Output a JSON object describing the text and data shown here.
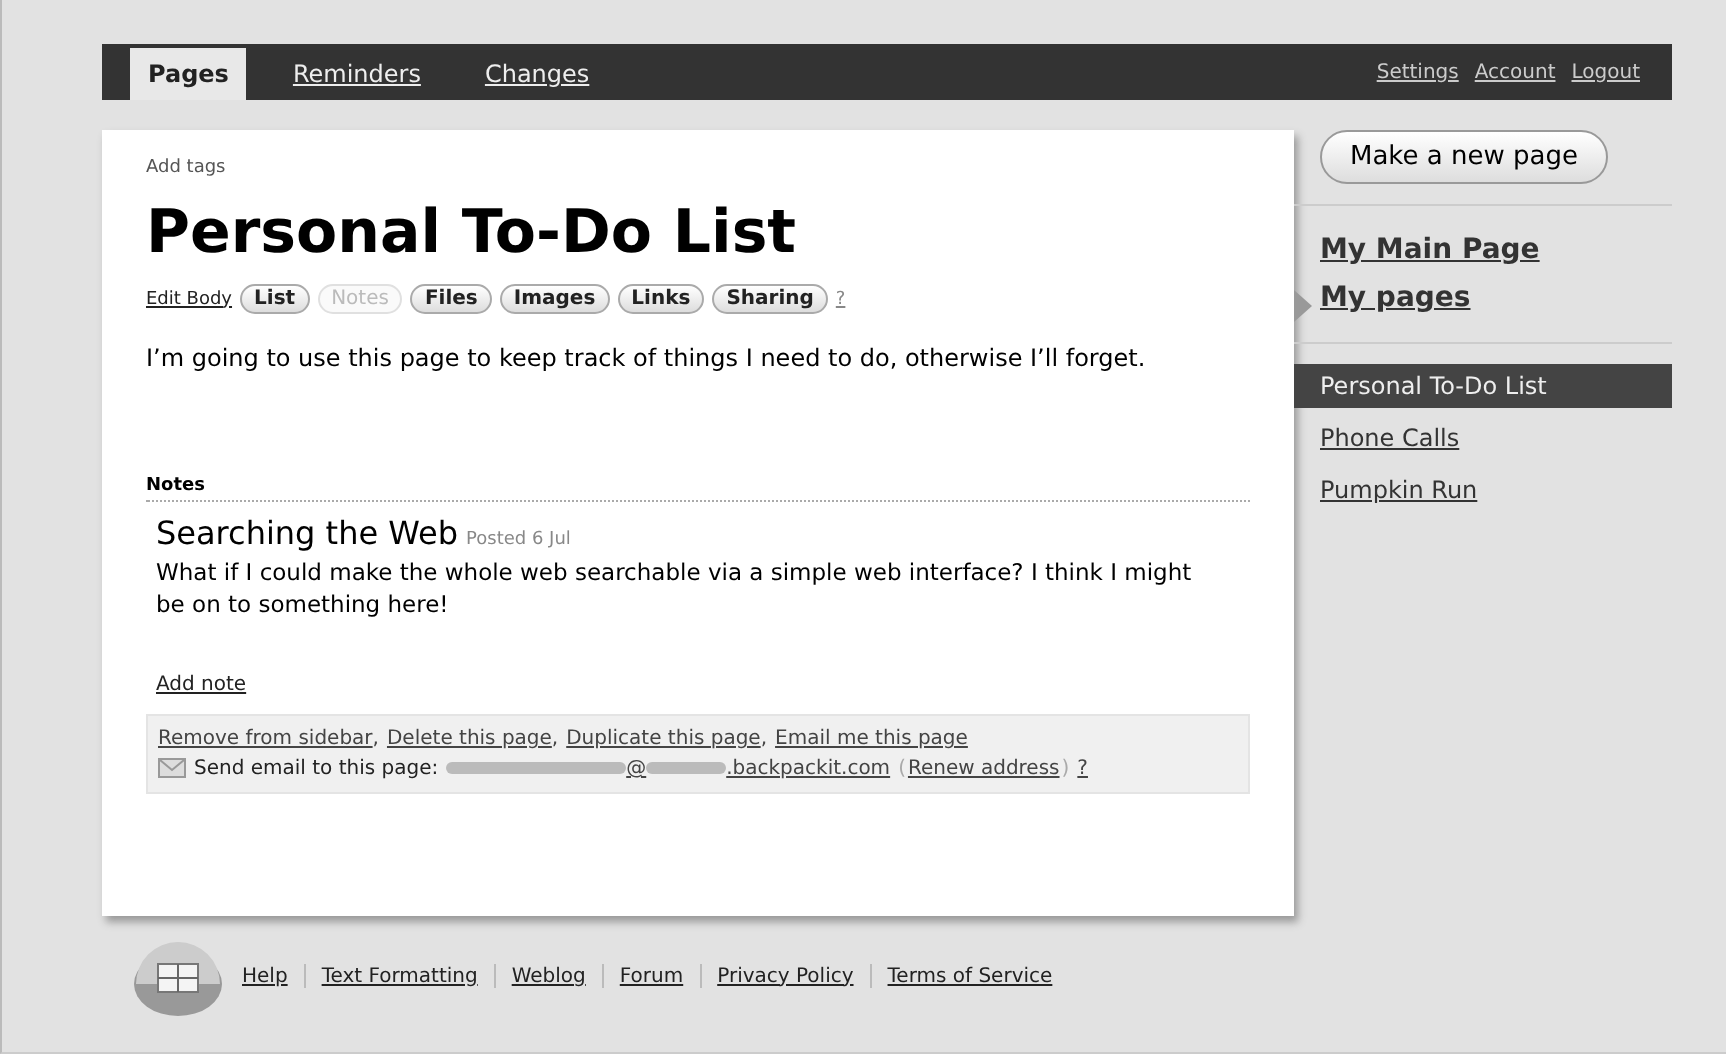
{
  "top_tabs": [
    {
      "label": "Pages",
      "selected": true
    },
    {
      "label": "Reminders",
      "selected": false
    },
    {
      "label": "Changes",
      "selected": false
    }
  ],
  "account_links": [
    "Settings",
    "Account",
    "Logout"
  ],
  "add_tags": "Add tags",
  "title": "Personal To-Do List",
  "edit_body": "Edit Body",
  "insert_buttons": [
    {
      "label": "List",
      "disabled": false
    },
    {
      "label": "Notes",
      "disabled": true
    },
    {
      "label": "Files",
      "disabled": false
    },
    {
      "label": "Images",
      "disabled": false
    },
    {
      "label": "Links",
      "disabled": false
    },
    {
      "label": "Sharing",
      "disabled": false
    }
  ],
  "help_mark": "?",
  "body": "I’m going to use this page to keep track of things I need to do, otherwise I’ll forget.",
  "notes": {
    "heading": "Notes",
    "items": [
      {
        "title": "Searching the Web",
        "posted": "Posted 6 Jul",
        "text": "What if I could make the whole web searchable via a simple web interface? I think I might be on to something here!"
      }
    ],
    "add_note": "Add note"
  },
  "page_actions": [
    "Remove from sidebar",
    "Delete this page",
    "Duplicate this page",
    "Email me this page"
  ],
  "action_separator": ",",
  "email": {
    "label": "Send email to this page:",
    "at": "@",
    "domain": ".backpackit.com",
    "renew": "Renew address",
    "brackets": [
      "(",
      ")"
    ],
    "help": "?"
  },
  "sidebar": {
    "new_page": "Make a new page",
    "main_page": "My Main Page",
    "my_pages": {
      "label": "My pages",
      "selected": true
    },
    "pages": [
      {
        "label": "Personal To-Do List",
        "selected": true
      },
      {
        "label": "Phone Calls",
        "selected": false
      },
      {
        "label": "Pumpkin Run",
        "selected": false
      }
    ]
  },
  "footer_links": [
    "Help",
    "Text Formatting",
    "Weblog",
    "Forum",
    "Privacy Policy",
    "Terms of Service"
  ]
}
